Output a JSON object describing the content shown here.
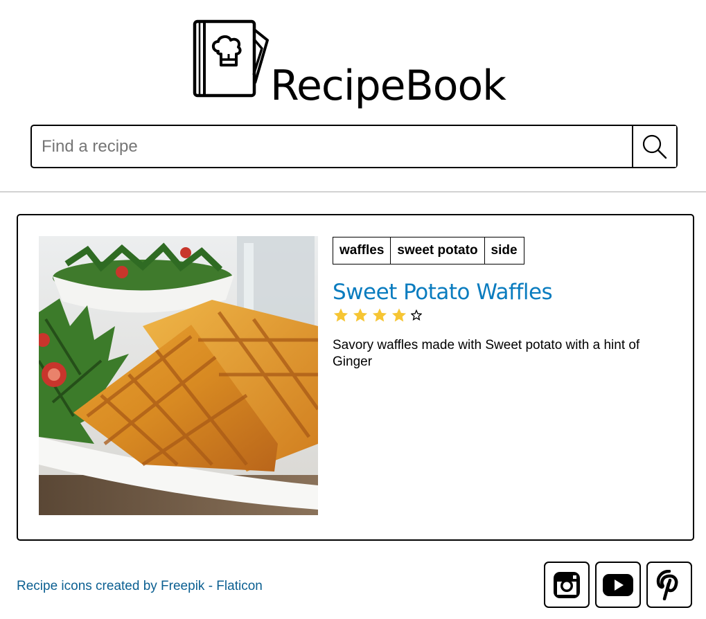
{
  "brand": {
    "name": "RecipeBook"
  },
  "search": {
    "placeholder": "Find a recipe"
  },
  "recipe": {
    "tags": [
      "waffles",
      "sweet potato",
      "side"
    ],
    "title": "Sweet Potato Waffles",
    "rating": 4,
    "rating_max": 5,
    "description": "Savory waffles made with Sweet potato with a hint of Ginger",
    "star_color": "#f6c533"
  },
  "footer": {
    "credit": "Recipe icons created by Freepik - Flaticon",
    "social": [
      "instagram-icon",
      "youtube-icon",
      "pinterest-icon"
    ]
  },
  "colors": {
    "title": "#0a7cbf",
    "link": "#0b5f91",
    "divider": "#d2d2d2"
  }
}
